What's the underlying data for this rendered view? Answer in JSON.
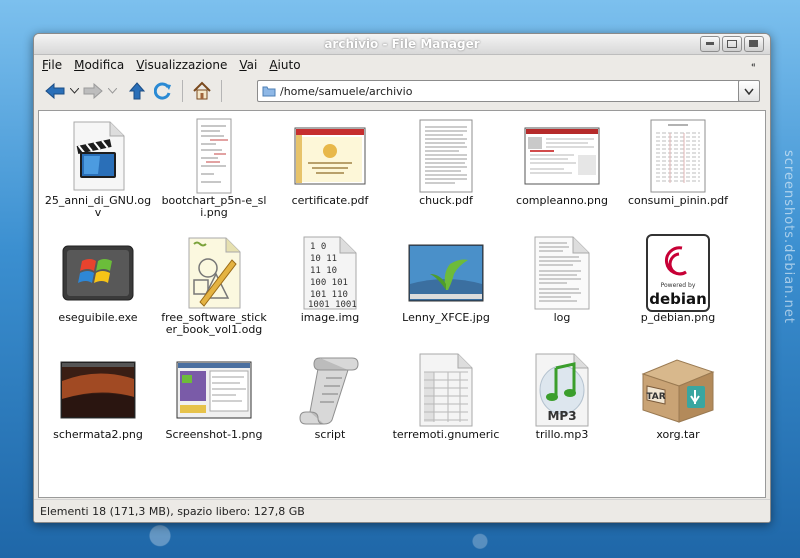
{
  "wallpaper": {
    "watermark": "screenshots.debian.net"
  },
  "window": {
    "title": "archivio - File Manager"
  },
  "menubar": {
    "items": [
      {
        "label": "File",
        "accel": "F",
        "rest": "ile"
      },
      {
        "label": "Modifica",
        "accel": "M",
        "rest": "odifica"
      },
      {
        "label": "Visualizzazione",
        "accel": "V",
        "rest": "isualizzazione"
      },
      {
        "label": "Vai",
        "accel": "V",
        "rest": "ai"
      },
      {
        "label": "Aiuto",
        "accel": "A",
        "rest": "iuto"
      }
    ]
  },
  "toolbar": {
    "buttons": [
      "back-icon",
      "forward-icon",
      "history-dropdown-icon",
      "up-icon",
      "reload-icon",
      "home-icon"
    ],
    "location": "/home/samuele/archivio"
  },
  "files": [
    {
      "name": "25_anni_di_GNU.ogv",
      "icon": "video-file-icon"
    },
    {
      "name": "bootchart_p5n-e_sli.png",
      "icon": "image-thumbnail-icon"
    },
    {
      "name": "certificate.pdf",
      "icon": "pdf-thumbnail-icon"
    },
    {
      "name": "chuck.pdf",
      "icon": "pdf-thumbnail-icon"
    },
    {
      "name": "compleanno.png",
      "icon": "image-thumbnail-icon"
    },
    {
      "name": "consumi_pinin.pdf",
      "icon": "pdf-thumbnail-icon"
    },
    {
      "name": "eseguibile.exe",
      "icon": "windows-executable-icon"
    },
    {
      "name": "free_software_sticker_book_vol1.odg",
      "icon": "drawing-document-icon"
    },
    {
      "name": "image.img",
      "icon": "disk-image-icon"
    },
    {
      "name": "Lenny_XFCE.jpg",
      "icon": "image-thumbnail-icon"
    },
    {
      "name": "log",
      "icon": "text-file-icon"
    },
    {
      "name": "p_debian.png",
      "icon": "debian-logo-thumbnail-icon"
    },
    {
      "name": "schermata2.png",
      "icon": "image-thumbnail-icon"
    },
    {
      "name": "Screenshot-1.png",
      "icon": "image-thumbnail-icon"
    },
    {
      "name": "script",
      "icon": "script-scroll-icon"
    },
    {
      "name": "terremoti.gnumeric",
      "icon": "spreadsheet-icon"
    },
    {
      "name": "trillo.mp3",
      "icon": "mp3-audio-icon"
    },
    {
      "name": "xorg.tar",
      "icon": "tar-archive-icon"
    }
  ],
  "icon_text": {
    "binary_lines": [
      "1   0",
      "10   11",
      "11   10",
      "100   101",
      "101   110",
      "1001   1001"
    ],
    "mp3": "MP3",
    "tar": "TAR",
    "debian_powered": "Powered by",
    "debian_word": "debian"
  },
  "statusbar": {
    "text": "Elementi 18 (171,3 MB), spazio libero: 127,8 GB"
  },
  "colors": {
    "accent_blue": "#2a6fb8",
    "debian_red": "#c70036"
  }
}
